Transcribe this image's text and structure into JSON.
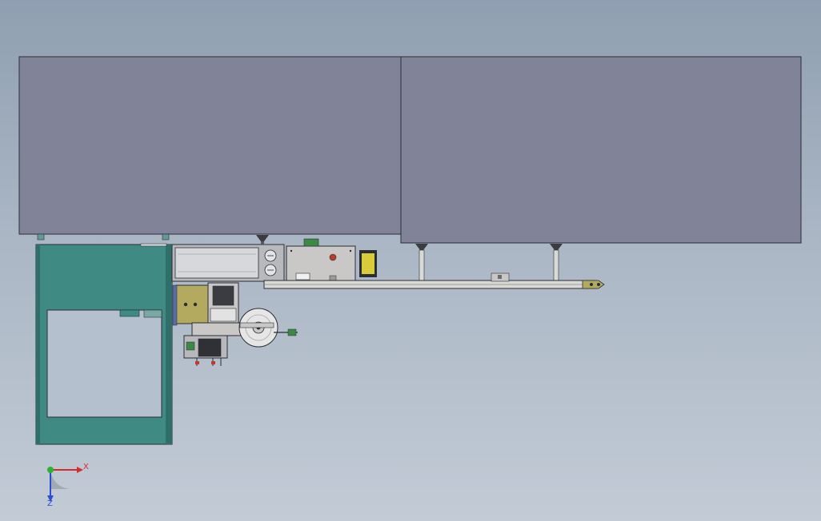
{
  "viewport": {
    "background_top": "#8f9fb1",
    "background_bottom": "#c2cbd6"
  },
  "colors": {
    "enclosure": "#818498",
    "frame_teal": "#3f8a83",
    "frame_teal_dark": "#2f6e69",
    "window_fill": "#b4c0cd",
    "panel_light": "#d7d8dc",
    "panel_mid": "#b8b9bd",
    "plate_gray": "#c9c8c6",
    "rail": "#d9d9d6",
    "olive": "#b3a95f",
    "switch_yellow": "#d8cc3a",
    "indicator_red": "#c0392b",
    "terminal_green": "#3b8a44",
    "edge": "#2b2d33"
  },
  "triad": {
    "x_label": "X",
    "z_label": "Z",
    "x_color": "#d62b2b",
    "y_color": "#2bb52b",
    "z_color": "#2b4ed6"
  }
}
